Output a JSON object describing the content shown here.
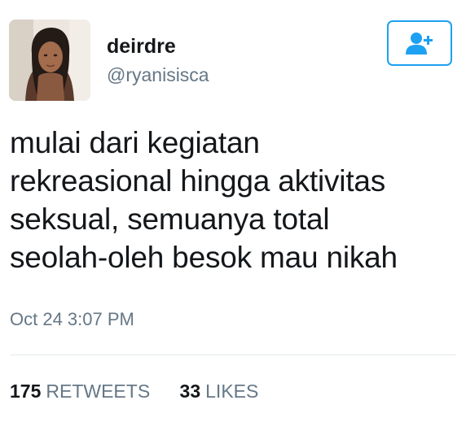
{
  "user": {
    "display_name": "deirdre",
    "handle": "@ryanisisca",
    "avatar": "profile-photo"
  },
  "follow_button": {
    "icon": "add-user-icon",
    "color": "#1da1f2"
  },
  "tweet": {
    "lines": [
      "mulai dari kegiatan",
      "rekreasional hingga aktivitas",
      "seksual, semuanya total",
      "seolah-oleh besok mau nikah"
    ],
    "timestamp": "Oct 24 3:07 PM"
  },
  "stats": {
    "retweets": {
      "count": "175",
      "label": "RETWEETS"
    },
    "likes": {
      "count": "33",
      "label": "LIKES"
    }
  }
}
